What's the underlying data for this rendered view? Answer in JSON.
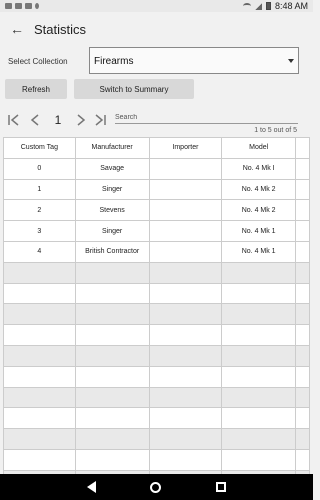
{
  "statusbar": {
    "time": "8:48 AM",
    "icons": [
      "notification-icon",
      "photo-icon",
      "image-icon",
      "location-icon",
      "wifi-icon",
      "signal-icon",
      "battery-icon"
    ]
  },
  "appbar": {
    "title": "Statistics",
    "back_icon": "arrow-left-icon"
  },
  "collection": {
    "label": "Select Collection",
    "selected": "Firearms"
  },
  "buttons": {
    "refresh": "Refresh",
    "summary": "Switch to Summary"
  },
  "pager": {
    "page": "1",
    "first_symbol": "|<",
    "prev_symbol": "<",
    "next_symbol": ">",
    "last_symbol": ">|",
    "search_placeholder": "Search",
    "count_text": "1 to 5 out of 5"
  },
  "table": {
    "headers": [
      "Custom Tag",
      "Manufacturer",
      "Importer",
      "Model",
      ""
    ],
    "rows": [
      [
        "0",
        "Savage",
        "",
        "No. 4 Mk I",
        ""
      ],
      [
        "1",
        "Singer",
        "",
        "No. 4 Mk 2",
        ""
      ],
      [
        "2",
        "Stevens",
        "",
        "No. 4 Mk 2",
        ""
      ],
      [
        "3",
        "Singer",
        "",
        "No. 4 Mk 1",
        ""
      ],
      [
        "4",
        "British Contractor",
        "",
        "No. 4 Mk 1",
        ""
      ],
      [
        "",
        "",
        "",
        "",
        ""
      ],
      [
        "",
        "",
        "",
        "",
        ""
      ],
      [
        "",
        "",
        "",
        "",
        ""
      ],
      [
        "",
        "",
        "",
        "",
        ""
      ],
      [
        "",
        "",
        "",
        "",
        ""
      ],
      [
        "",
        "",
        "",
        "",
        ""
      ],
      [
        "",
        "",
        "",
        "",
        ""
      ],
      [
        "",
        "",
        "",
        "",
        ""
      ],
      [
        "",
        "",
        "",
        "",
        ""
      ],
      [
        "",
        "",
        "",
        "",
        ""
      ],
      [
        "",
        "",
        "",
        "",
        ""
      ]
    ]
  },
  "navbar": {
    "icons": [
      "nav-back-icon",
      "nav-home-icon",
      "nav-recent-icon"
    ]
  },
  "colors": {
    "background": "#f1f1f1",
    "button": "#d8d8d8",
    "row_shade": "#e9e9e9",
    "navbar": "#000000"
  }
}
